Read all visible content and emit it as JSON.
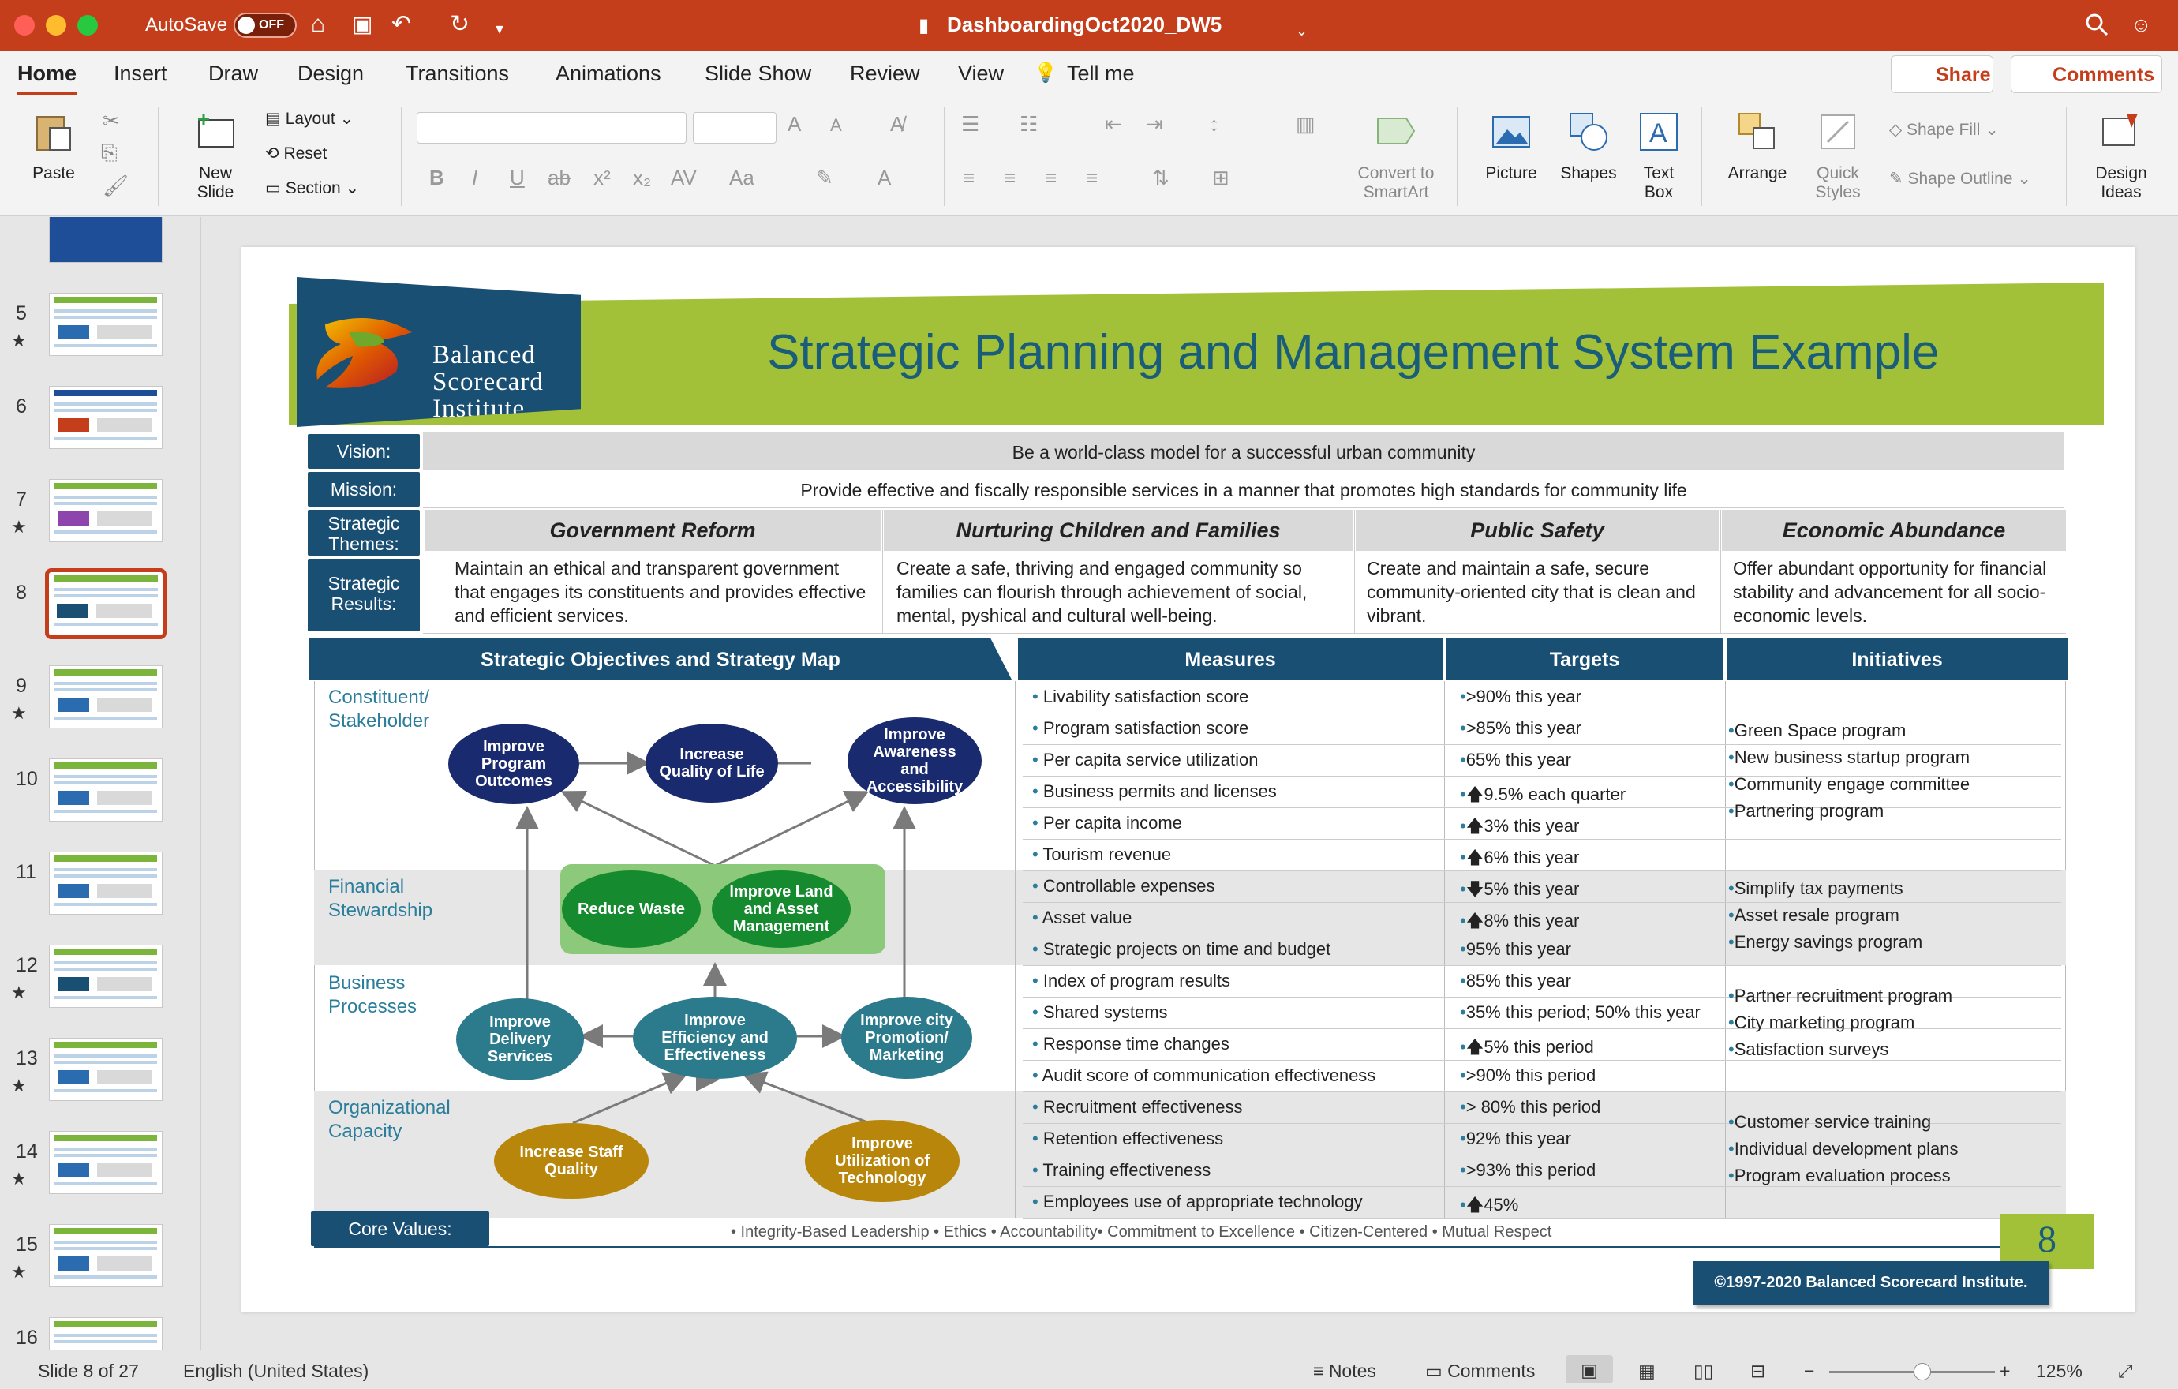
{
  "titlebar": {
    "autosave": "AutoSave",
    "toggle": "OFF",
    "document": "DashboardingOct2020_DW5"
  },
  "tabs": [
    "Home",
    "Insert",
    "Draw",
    "Design",
    "Transitions",
    "Animations",
    "Slide Show",
    "Review",
    "View",
    "Tell me"
  ],
  "share": "Share",
  "comments_btn": "Comments",
  "ribbon": {
    "paste": "Paste",
    "new_slide": "New\nSlide",
    "layout": "Layout",
    "reset": "Reset",
    "section": "Section",
    "convert": "Convert to\nSmartArt",
    "picture": "Picture",
    "shapes": "Shapes",
    "textbox": "Text\nBox",
    "arrange": "Arrange",
    "quick_styles": "Quick\nStyles",
    "shape_fill": "Shape Fill",
    "shape_outline": "Shape Outline",
    "design_ideas": "Design\nIdeas"
  },
  "thumbs": [
    {
      "num": "5",
      "star": true
    },
    {
      "num": "6",
      "star": false
    },
    {
      "num": "7",
      "star": true
    },
    {
      "num": "8",
      "star": false
    },
    {
      "num": "9",
      "star": true
    },
    {
      "num": "10",
      "star": false
    },
    {
      "num": "11",
      "star": false
    },
    {
      "num": "12",
      "star": true
    },
    {
      "num": "13",
      "star": true
    },
    {
      "num": "14",
      "star": true
    },
    {
      "num": "15",
      "star": true
    },
    {
      "num": "16",
      "star": false
    }
  ],
  "slide": {
    "title": "Strategic Planning and Management System Example",
    "logo": [
      "Balanced",
      "Scorecard",
      "Institute"
    ],
    "vision_label": "Vision:",
    "vision": "Be a world-class model for a successful urban community",
    "mission_label": "Mission:",
    "mission": "Provide effective and fiscally responsible services in a manner that promotes high standards for community life",
    "themes_label": "Strategic\nThemes:",
    "results_label": "Strategic\nResults:",
    "themes": [
      "Government Reform",
      "Nurturing Children and Families",
      "Public Safety",
      "Economic Abundance"
    ],
    "results": [
      "Maintain an ethical and transparent government that engages its constituents and provides effective and efficient services.",
      "Create a safe, thriving and engaged community so families can flourish through achievement of social, mental, pyshical and cultural well-being.",
      "Create and maintain a safe, secure community-oriented city that is clean and vibrant.",
      "Offer abundant opportunity for financial stability and advancement for all socio-economic levels."
    ],
    "col_headers": [
      "Strategic Objectives and Strategy Map",
      "Measures",
      "Targets",
      "Initiatives"
    ],
    "perspectives": [
      "Constituent/\nStakeholder",
      "Financial\nStewardship",
      "Business\nProcesses",
      "Organizational\nCapacity"
    ],
    "objectives": {
      "o1": "Improve\nProgram\nOutcomes",
      "o2": "Increase\nQuality of Life",
      "o3": "Improve\nAwareness\nand\nAccessibility",
      "f1": "Reduce Waste",
      "f2": "Improve Land\nand Asset\nManagement",
      "b1": "Improve\nDelivery\nServices",
      "b2": "Improve\nEfficiency and\nEffectiveness",
      "b3": "Improve city\nPromotion/\nMarketing",
      "c1": "Increase Staff\nQuality",
      "c2": "Improve\nUtilization of\nTechnology"
    },
    "measures": [
      "Livability satisfaction score",
      "Program satisfaction score",
      "Per capita service utilization",
      "Business permits and licenses",
      "Per capita income",
      "Tourism revenue",
      "Controllable expenses",
      "Asset value",
      "Strategic projects on time and budget",
      "Index of program results",
      "Shared systems",
      "Response time changes",
      "Audit score of communication effectiveness",
      "Recruitment effectiveness",
      "Retention effectiveness",
      "Training effectiveness",
      "Employees use of appropriate technology"
    ],
    "targets": [
      ">90% this year",
      ">85% this year",
      "65% this year",
      "🡅9.5% each quarter",
      "🡅3% this year",
      "🡅6% this year",
      "🡇5% this year",
      "🡅8% this year",
      "95% this year",
      "85% this year",
      "35% this period; 50% this year",
      "🡅5% this period",
      ">90% this period",
      "> 80% this period",
      "92% this year",
      ">93% this period",
      "🡅45%"
    ],
    "initiatives": [
      [
        "Green Space program",
        "New business startup program",
        "Community engage committee",
        "Partnering program"
      ],
      [
        "Simplify tax payments",
        "Asset resale program",
        "Energy savings program"
      ],
      [
        "Partner recruitment program",
        "City marketing program",
        "Satisfaction surveys"
      ],
      [
        "Customer service training",
        "Individual development plans",
        "Program evaluation process"
      ]
    ],
    "core_values_label": "Core Values:",
    "core_values": "• Integrity-Based Leadership • Ethics • Accountability• Commitment to Excellence • Citizen-Centered • Mutual Respect",
    "copyright": "©1997-2020 Balanced Scorecard Institute.",
    "page_number": "8"
  },
  "statusbar": {
    "slide": "Slide 8 of 27",
    "language": "English (United States)",
    "notes": "Notes",
    "comments": "Comments",
    "zoom": "125%"
  }
}
